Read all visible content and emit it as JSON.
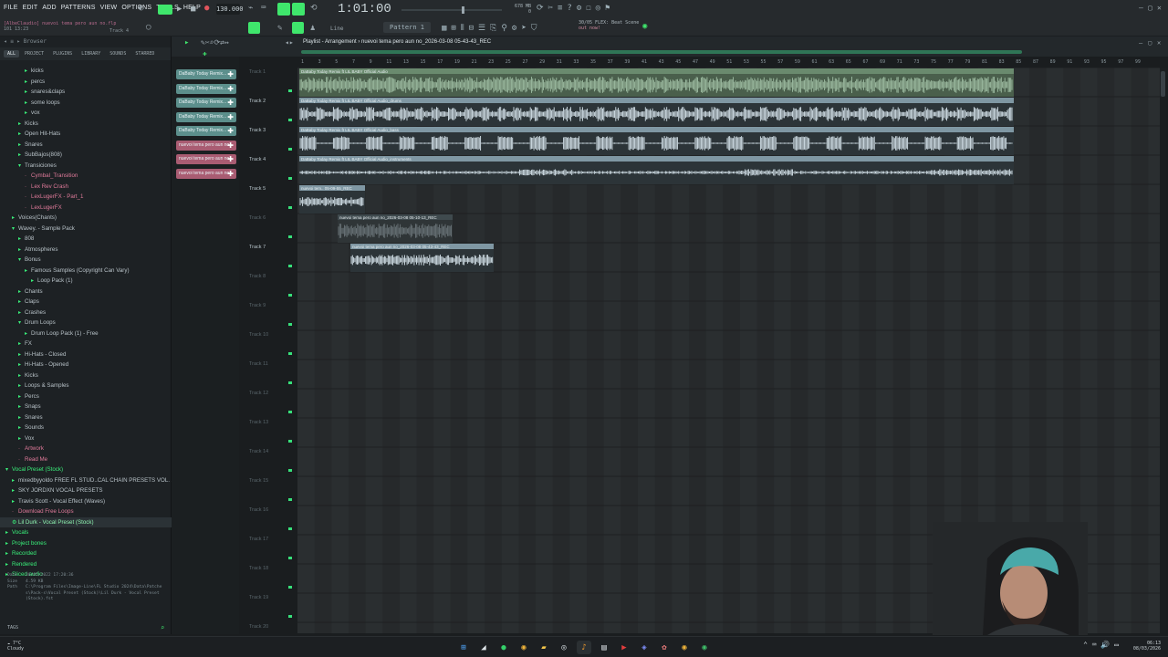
{
  "menu": [
    "FILE",
    "EDIT",
    "ADD",
    "PATTERNS",
    "VIEW",
    "OPTIONS",
    "TOOLS",
    "HELP"
  ],
  "tempo": "130.000",
  "time": "1:01:00",
  "pattern": "Pattern 1",
  "hint": {
    "line1": "[AlbeClaudio] nuevoi tema pero aun no.flp",
    "line2": "101 13:23",
    "track": "Track 4"
  },
  "cpu": {
    "mem": "678 MB",
    "poly": "0"
  },
  "news": {
    "line1": "30/05  FLEX: Beat Scene",
    "line2": "out now!"
  },
  "snap": "Line",
  "playlist_title": "Playlist - Arrangement  ›  nuevoi tema pero aun no_2026-03-08 05-43-43_REC",
  "browser": {
    "header": "Browser",
    "tabs": [
      "ALL",
      "PROJECT",
      "PLUGINS",
      "LIBRARY",
      "SOUNDS",
      "STARRED"
    ],
    "tree": [
      {
        "label": "kicks",
        "level": 3,
        "icon": "folder"
      },
      {
        "label": "percs",
        "level": 3,
        "icon": "folder"
      },
      {
        "label": "snares&claps",
        "level": 3,
        "icon": "folder"
      },
      {
        "label": "some loops",
        "level": 3,
        "icon": "folder"
      },
      {
        "label": "vox",
        "level": 3,
        "icon": "folder"
      },
      {
        "label": "Kicks",
        "level": 2,
        "icon": "folder"
      },
      {
        "label": "Open Hit-Hats",
        "level": 2,
        "icon": "folder"
      },
      {
        "label": "Snares",
        "level": 2,
        "icon": "folder"
      },
      {
        "label": "SubBajos(808)",
        "level": 2,
        "icon": "folder"
      },
      {
        "label": "Transiciones",
        "level": 2,
        "icon": "folder-open"
      },
      {
        "label": "Cymbal_Transition",
        "level": 3,
        "icon": "file"
      },
      {
        "label": "Lex Rev Crash",
        "level": 3,
        "icon": "file"
      },
      {
        "label": "LexLugerFX - Part_1",
        "level": 3,
        "icon": "file"
      },
      {
        "label": "LexLugerFX",
        "level": 3,
        "icon": "file"
      },
      {
        "label": "Voices(Chants)",
        "level": 1,
        "icon": "folder"
      },
      {
        "label": "Wavey. - Sample Pack",
        "level": 1,
        "icon": "folder-open"
      },
      {
        "label": "808",
        "level": 2,
        "icon": "folder"
      },
      {
        "label": "Atmospheres",
        "level": 2,
        "icon": "folder"
      },
      {
        "label": "Bonus",
        "level": 2,
        "icon": "folder-open"
      },
      {
        "label": "Famous Samples (Copyright Can Vary)",
        "level": 3,
        "icon": "folder"
      },
      {
        "label": "Loop Pack (1)",
        "level": 4,
        "icon": "folder"
      },
      {
        "label": "Chants",
        "level": 2,
        "icon": "folder"
      },
      {
        "label": "Claps",
        "level": 2,
        "icon": "folder"
      },
      {
        "label": "Crashes",
        "level": 2,
        "icon": "folder"
      },
      {
        "label": "Drum Loops",
        "level": 2,
        "icon": "folder-open"
      },
      {
        "label": "Drum Loop Pack (1) - Free",
        "level": 3,
        "icon": "folder"
      },
      {
        "label": "FX",
        "level": 2,
        "icon": "folder"
      },
      {
        "label": "Hi-Hats - Closed",
        "level": 2,
        "icon": "folder"
      },
      {
        "label": "Hi-Hats - Opened",
        "level": 2,
        "icon": "folder"
      },
      {
        "label": "Kicks",
        "level": 2,
        "icon": "folder"
      },
      {
        "label": "Loops & Samples",
        "level": 2,
        "icon": "folder"
      },
      {
        "label": "Percs",
        "level": 2,
        "icon": "folder"
      },
      {
        "label": "Snaps",
        "level": 2,
        "icon": "folder"
      },
      {
        "label": "Snares",
        "level": 2,
        "icon": "folder"
      },
      {
        "label": "Sounds",
        "level": 2,
        "icon": "folder"
      },
      {
        "label": "Vox",
        "level": 2,
        "icon": "folder"
      },
      {
        "label": "Artwork",
        "level": 2,
        "icon": "file"
      },
      {
        "label": "Read Me",
        "level": 2,
        "icon": "file"
      },
      {
        "label": "Vocal Preset (Stock)",
        "level": 0,
        "icon": "folder-open"
      },
      {
        "label": "mixedbyyoldo FREE FL STUD..CAL CHAIN PRESETS VOL. 2",
        "level": 1,
        "icon": "folder"
      },
      {
        "label": "SKY JORDXN VOCAL PRESETS",
        "level": 1,
        "icon": "folder"
      },
      {
        "label": "Travis Scott - Vocal Effect (Waves)",
        "level": 1,
        "icon": "folder"
      },
      {
        "label": "Download Free Loops",
        "level": 1,
        "icon": "file"
      },
      {
        "label": "Lil Durk - Vocal Preset (Stock)",
        "level": 1,
        "icon": "preset",
        "selected": true
      },
      {
        "label": "Vocals",
        "level": 0,
        "icon": "folder"
      },
      {
        "label": "Project bones",
        "level": 0,
        "icon": "folder"
      },
      {
        "label": "Recorded",
        "level": 0,
        "icon": "folder"
      },
      {
        "label": "Rendered",
        "level": 0,
        "icon": "folder"
      },
      {
        "label": "Sliced audio",
        "level": 0,
        "icon": "folder"
      }
    ],
    "info": {
      "date_label": "Date",
      "date": "30/05/2022 17:20:36",
      "size_label": "Size",
      "size": "4.59 KB",
      "path_label": "Path",
      "path": "C:\\Program Files\\Image-Line\\FL Studio 2024\\Data\\Patches\\Pack-s\\Vocal Preset (Stock)\\Lil Durk - Vocal Preset (Stock).fst"
    },
    "tags": "TAGS"
  },
  "clips_panel": [
    {
      "label": "DaBaby Today Remix...",
      "type": "pattern"
    },
    {
      "label": "DaBaby Today Remix...",
      "type": "pattern"
    },
    {
      "label": "DaBaby Today Remix...",
      "type": "pattern"
    },
    {
      "label": "DaBaby Today Remix...",
      "type": "pattern"
    },
    {
      "label": "DaBaby Today Remix...",
      "type": "pattern"
    },
    {
      "label": "nuevoi tema pero aun no...",
      "type": "audio"
    },
    {
      "label": "nuevoi tema pero aun no...",
      "type": "audio"
    },
    {
      "label": "nuevoi tema pero aun no...",
      "type": "audio"
    }
  ],
  "ruler": [
    "1",
    "3",
    "5",
    "7",
    "9",
    "11",
    "13",
    "15",
    "17",
    "19",
    "21",
    "23",
    "25",
    "27",
    "29",
    "31",
    "33",
    "35",
    "37",
    "39",
    "41",
    "43",
    "45",
    "47",
    "49",
    "51",
    "53",
    "55",
    "57",
    "59",
    "61",
    "63",
    "65",
    "67",
    "69",
    "71",
    "73",
    "75",
    "77",
    "79",
    "81",
    "83",
    "85",
    "87",
    "89",
    "91",
    "93",
    "95",
    "97",
    "99"
  ],
  "tracks": [
    "Track 1",
    "Track 2",
    "Track 3",
    "Track 4",
    "Track 5",
    "Track 6",
    "Track 7",
    "Track 8",
    "Track 9",
    "Track 10",
    "Track 11",
    "Track 12",
    "Track 13",
    "Track 14",
    "Track 15",
    "Track 16",
    "Track 17",
    "Track 18",
    "Track 19",
    "Track 20"
  ],
  "clips": [
    {
      "track": 1,
      "name": "DaBaby Today Remix ft LIL BABY Official Audio",
      "kind": "full",
      "color": "#6a8a6e"
    },
    {
      "track": 2,
      "name": "DaBaby Today Remix ft LIL BABY Official Audio_drums",
      "kind": "drums",
      "color": "#7f97a3"
    },
    {
      "track": 3,
      "name": "DaBaby Today Remix ft LIL BABY Official Audio_bass",
      "kind": "bass",
      "color": "#7f97a3"
    },
    {
      "track": 4,
      "name": "DaBaby Today Remix ft LIL BABY Official Audio_instruments",
      "kind": "inst",
      "color": "#7f97a3"
    },
    {
      "track": 5,
      "name": "nuevoi tem.. 05-09-55_REC",
      "kind": "short",
      "color": "#7f97a3"
    },
    {
      "track": 6,
      "name": "nuevoi tema pero aun no_2026-03-08 05-10-13_REC",
      "kind": "ghost",
      "color": "#3f4a4e"
    },
    {
      "track": 7,
      "name": "nuevoi tema pero aun no_2026-03-08 05-43-43_REC",
      "kind": "rec",
      "color": "#7f97a3"
    }
  ],
  "taskbar": {
    "weather_temp": "7°C",
    "weather_desc": "Cloudy",
    "time": "06:13",
    "date": "08/03/2026"
  }
}
